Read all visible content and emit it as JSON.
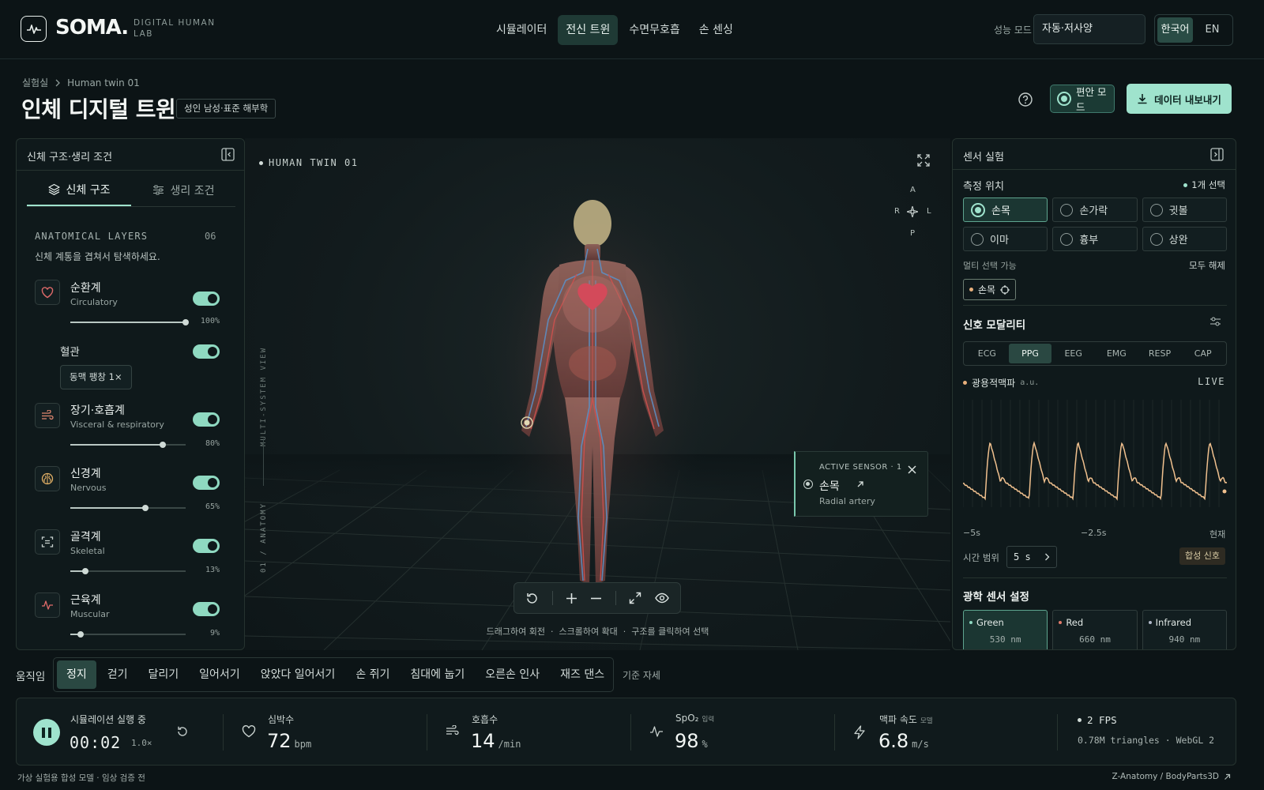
{
  "header": {
    "logo": "SOMA.",
    "logo_sub": "DIGITAL HUMAN LAB",
    "nav": [
      "시뮬레이터",
      "전신 트윈",
      "수면무호흡",
      "손 센싱"
    ],
    "perf_label": "성능 모드",
    "perf_value": "자동·저사양",
    "lang_ko": "한국어",
    "lang_en": "EN"
  },
  "page": {
    "crumb_root": "실험실",
    "crumb_leaf": "Human twin 01",
    "title": "인체 디지털 트윈",
    "badge": "성인 남성·표준 해부학",
    "comfort": "편안 모드",
    "export": "데이터 내보내기"
  },
  "left": {
    "title": "신체 구조·생리 조건",
    "tab_structure": "신체 구조",
    "tab_physio": "생리 조건",
    "layers_head": "ANATOMICAL LAYERS",
    "layers_count": "06",
    "layers_desc": "신체 계통을 겹쳐서 탐색하세요.",
    "layers": [
      {
        "name": "순환계",
        "en": "Circulatory",
        "value": 100,
        "label": "100%"
      },
      {
        "name": "장기·호흡계",
        "en": "Visceral & respiratory",
        "value": 80,
        "label": "80%"
      },
      {
        "name": "신경계",
        "en": "Nervous",
        "value": 65,
        "label": "65%"
      },
      {
        "name": "골격계",
        "en": "Skeletal",
        "value": 13,
        "label": "13%"
      },
      {
        "name": "근육계",
        "en": "Muscular",
        "value": 9,
        "label": "9%"
      }
    ],
    "sub_name": "혈관",
    "sub_badge": "동맥 팽창 1×"
  },
  "viewport": {
    "label": "HUMAN TWIN 01",
    "side_top": "MULTI-SYSTEM VIEW",
    "side_bottom": "01 / ANATOMY",
    "compass": {
      "a": "A",
      "p": "P",
      "r": "R",
      "l": "L"
    },
    "sensor_title": "ACTIVE SENSOR · 1",
    "sensor_name": "손목",
    "sensor_sub": "Radial artery",
    "hint": "드래그하여 회전  ·  스크롤하여 확대  ·  구조를 클릭하여 선택"
  },
  "right": {
    "title": "센서 실험",
    "loc_label": "측정 위치",
    "loc_count": "1개 선택",
    "locations": [
      "손목",
      "손가락",
      "귓볼",
      "이마",
      "흉부",
      "상완"
    ],
    "multi": "멀티 선택 가능",
    "clear": "모두 해제",
    "chip": "손목",
    "modality_title": "신호 모달리티",
    "modalities": [
      "ECG",
      "PPG",
      "EEG",
      "EMG",
      "RESP",
      "CAP"
    ],
    "wave_label": "광용적맥파",
    "wave_unit": "a.u.",
    "live": "LIVE",
    "t_left": "−5s",
    "t_mid": "−2.5s",
    "t_right": "현재",
    "range_label": "시간 범위",
    "range_value": "5 s",
    "synth": "합성 신호",
    "optic_title": "광학 센서 설정",
    "optics": [
      {
        "name": "Green",
        "wl": "530 nm",
        "color": "#8fd9c1"
      },
      {
        "name": "Red",
        "wl": "660 nm",
        "color": "#e07a6a"
      },
      {
        "name": "Infrared",
        "wl": "940 nm",
        "color": "#b0b8c8"
      }
    ]
  },
  "motion": {
    "label": "움직임",
    "items": [
      "정지",
      "걷기",
      "달리기",
      "일어서기",
      "앉았다 일어서기",
      "손 쥐기",
      "침대에 눕기",
      "오른손 인사",
      "재즈 댄스"
    ],
    "ref": "기준 자세"
  },
  "status": {
    "running": "시뮬레이션 실행 중",
    "time": "00:02",
    "mult": "1.0×",
    "hr_label": "심박수",
    "hr": "72",
    "hr_unit": "bpm",
    "rr_label": "호흡수",
    "rr": "14",
    "rr_unit": "/min",
    "spo2_label": "SpO₂",
    "spo2_tag": "입력",
    "spo2": "98",
    "spo2_unit": "%",
    "pwv_label": "맥파 속도",
    "pwv_tag": "모델",
    "pwv": "6.8",
    "pwv_unit": "m/s",
    "fps": "2 FPS",
    "tri": "0.78M triangles · WebGL 2"
  },
  "footer": {
    "left": "가상 실험용 합성 모델 · 임상 검증 전",
    "right": "Z-Anatomy / BodyParts3D"
  }
}
